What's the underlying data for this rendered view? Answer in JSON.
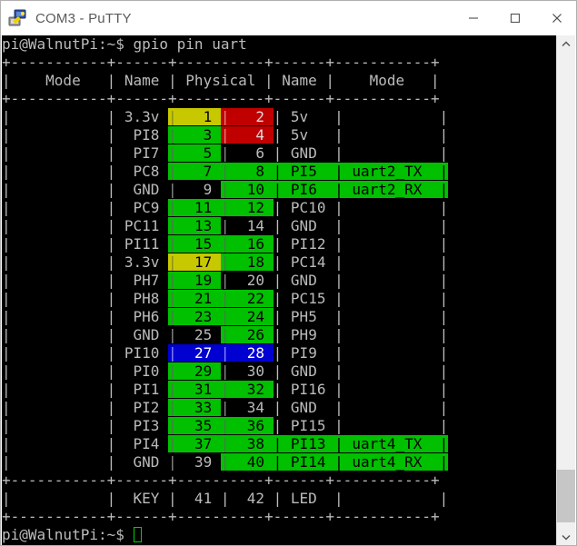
{
  "window": {
    "title": "COM3 - PuTTY",
    "icon": "putty-terminal-icon",
    "controls": {
      "minimize": "minimize-button",
      "maximize": "maximize-button",
      "close": "close-button"
    }
  },
  "terminal": {
    "prompt_top": "pi@WalnutPi:~$ gpio pin uart",
    "prompt_bottom": "pi@WalnutPi:~$ ",
    "border_line": "+-----------+------+----------+------+-----------+",
    "headers": {
      "mode_left": "Mode",
      "name_left": "Name",
      "physical": "Physical",
      "name_right": "Name",
      "mode_right": "Mode"
    },
    "header_line": "|    Mode   | Name | Physical | Name |    Mode   |",
    "rows": [
      {
        "mode_l": "",
        "name_l": "3.3v",
        "pin_l": "1",
        "pin_r": "2",
        "name_r": "5v",
        "mode_r": "",
        "hl_l": "yellow",
        "hl_r": "red"
      },
      {
        "mode_l": "",
        "name_l": "PI8",
        "pin_l": "3",
        "pin_r": "4",
        "name_r": "5v",
        "mode_r": "",
        "hl_l": "green",
        "hl_r": "red"
      },
      {
        "mode_l": "",
        "name_l": "PI7",
        "pin_l": "5",
        "pin_r": "6",
        "name_r": "GND",
        "mode_r": "",
        "hl_l": "green",
        "hl_r": "black"
      },
      {
        "mode_l": "",
        "name_l": "PC8",
        "pin_l": "7",
        "pin_r": "8",
        "name_r": "PI5",
        "mode_r": "uart2_TX",
        "hl_l": "green",
        "hl_r": "green",
        "mode_r_hl": "green"
      },
      {
        "mode_l": "",
        "name_l": "GND",
        "pin_l": "9",
        "pin_r": "10",
        "name_r": "PI6",
        "mode_r": "uart2_RX",
        "hl_l": "black",
        "hl_r": "green",
        "mode_r_hl": "green"
      },
      {
        "mode_l": "",
        "name_l": "PC9",
        "pin_l": "11",
        "pin_r": "12",
        "name_r": "PC10",
        "mode_r": "",
        "hl_l": "green",
        "hl_r": "green"
      },
      {
        "mode_l": "",
        "name_l": "PC11",
        "pin_l": "13",
        "pin_r": "14",
        "name_r": "GND",
        "mode_r": "",
        "hl_l": "green",
        "hl_r": "black"
      },
      {
        "mode_l": "",
        "name_l": "PI11",
        "pin_l": "15",
        "pin_r": "16",
        "name_r": "PI12",
        "mode_r": "",
        "hl_l": "green",
        "hl_r": "green"
      },
      {
        "mode_l": "",
        "name_l": "3.3v",
        "pin_l": "17",
        "pin_r": "18",
        "name_r": "PC14",
        "mode_r": "",
        "hl_l": "yellow",
        "hl_r": "green"
      },
      {
        "mode_l": "",
        "name_l": "PH7",
        "pin_l": "19",
        "pin_r": "20",
        "name_r": "GND",
        "mode_r": "",
        "hl_l": "green",
        "hl_r": "black"
      },
      {
        "mode_l": "",
        "name_l": "PH8",
        "pin_l": "21",
        "pin_r": "22",
        "name_r": "PC15",
        "mode_r": "",
        "hl_l": "green",
        "hl_r": "green"
      },
      {
        "mode_l": "",
        "name_l": "PH6",
        "pin_l": "23",
        "pin_r": "24",
        "name_r": "PH5",
        "mode_r": "",
        "hl_l": "green",
        "hl_r": "green"
      },
      {
        "mode_l": "",
        "name_l": "GND",
        "pin_l": "25",
        "pin_r": "26",
        "name_r": "PH9",
        "mode_r": "",
        "hl_l": "black",
        "hl_r": "green"
      },
      {
        "mode_l": "",
        "name_l": "PI10",
        "pin_l": "27",
        "pin_r": "28",
        "name_r": "PI9",
        "mode_r": "",
        "hl_l": "blue",
        "hl_r": "blue"
      },
      {
        "mode_l": "",
        "name_l": "PI0",
        "pin_l": "29",
        "pin_r": "30",
        "name_r": "GND",
        "mode_r": "",
        "hl_l": "green",
        "hl_r": "black"
      },
      {
        "mode_l": "",
        "name_l": "PI1",
        "pin_l": "31",
        "pin_r": "32",
        "name_r": "PI16",
        "mode_r": "",
        "hl_l": "green",
        "hl_r": "green"
      },
      {
        "mode_l": "",
        "name_l": "PI2",
        "pin_l": "33",
        "pin_r": "34",
        "name_r": "GND",
        "mode_r": "",
        "hl_l": "green",
        "hl_r": "black"
      },
      {
        "mode_l": "",
        "name_l": "PI3",
        "pin_l": "35",
        "pin_r": "36",
        "name_r": "PI15",
        "mode_r": "",
        "hl_l": "green",
        "hl_r": "green"
      },
      {
        "mode_l": "",
        "name_l": "PI4",
        "pin_l": "37",
        "pin_r": "38",
        "name_r": "PI13",
        "mode_r": "uart4_TX",
        "hl_l": "green",
        "hl_r": "green",
        "mode_r_hl": "green"
      },
      {
        "mode_l": "",
        "name_l": "GND",
        "pin_l": "39",
        "pin_r": "40",
        "name_r": "PI14",
        "mode_r": "uart4_RX",
        "hl_l": "black",
        "hl_r": "green",
        "mode_r_hl": "green"
      }
    ],
    "extra_rows": [
      {
        "mode_l": "",
        "name_l": "KEY",
        "pin_l": "41",
        "pin_r": "42",
        "name_r": "LED",
        "mode_r": "",
        "hl_l": "none",
        "hl_r": "none"
      }
    ],
    "colors": {
      "background": "#000000",
      "foreground": "#bbbbbb",
      "green": "#00c000",
      "yellow": "#c8c800",
      "red": "#c00000",
      "blue": "#0000d0"
    }
  },
  "scrollbar": {
    "up_arrow": "scroll-up-arrow",
    "down_arrow": "scroll-down-arrow",
    "thumb": "scroll-thumb"
  }
}
